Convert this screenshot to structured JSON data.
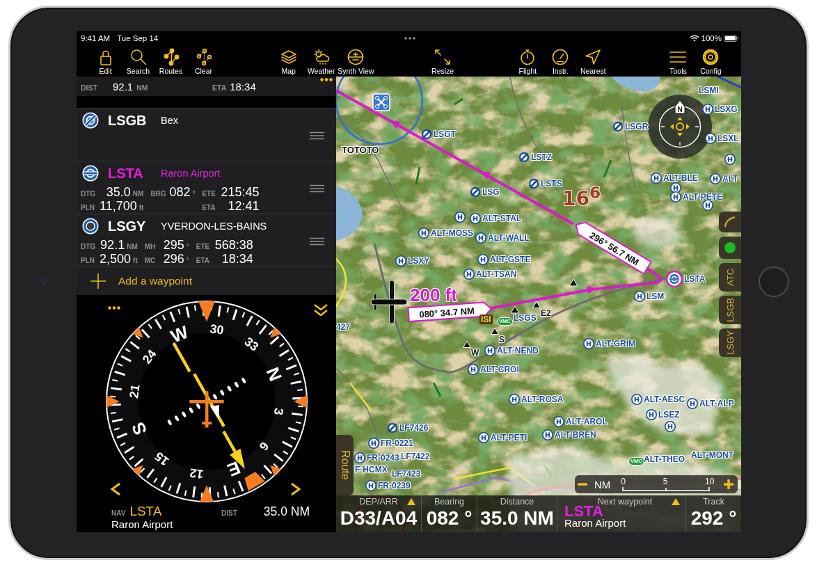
{
  "status_bar": {
    "time": "9:41 AM",
    "date": "Tue Sep 14",
    "battery": "100%"
  },
  "toolbar": {
    "groups": [
      [
        "Edit",
        "Search",
        "Routes",
        "Clear"
      ],
      [
        "Map",
        "Weather",
        "Synth View"
      ],
      [
        "Resize"
      ],
      [
        "Flight",
        "Instr.",
        "Nearest"
      ],
      [
        "Tools",
        "Config"
      ]
    ]
  },
  "route_panel": {
    "summary": [
      {
        "label": "DIST",
        "value": "92.1",
        "unit": "NM"
      },
      {
        "label": "ETA",
        "value": "18:34"
      }
    ],
    "waypoints": [
      {
        "ident": "LSGB",
        "name": "Bex",
        "kind": "aerodrome",
        "active": false
      },
      {
        "ident": "LSTA",
        "name": "Raron Airport",
        "kind": "airport",
        "active": true,
        "stats": [
          [
            {
              "label": "DTG",
              "value": "35.0",
              "unit": "NM"
            },
            {
              "label": "BRG",
              "value": "082",
              "unit": "°"
            },
            {
              "label": "ETE",
              "value": "215:45"
            }
          ],
          [
            {
              "label": "PLN",
              "value": "11,700",
              "unit": "ft"
            },
            {
              "label": "ETA",
              "value": "12:41"
            }
          ]
        ]
      },
      {
        "ident": "LSGY",
        "name": "YVERDON-LES-BAINS",
        "kind": "airfield",
        "active": false,
        "stats": [
          [
            {
              "label": "DTG",
              "value": "92.1",
              "unit": "NM"
            },
            {
              "label": "MH",
              "value": "295",
              "unit": "°"
            },
            {
              "label": "ETE",
              "value": "568:38"
            }
          ],
          [
            {
              "label": "PLN",
              "value": "2,500",
              "unit": "ft"
            },
            {
              "label": "MC",
              "value": "296",
              "unit": "°"
            },
            {
              "label": "ETA",
              "value": "18:34"
            }
          ]
        ]
      }
    ],
    "add_waypoint": "Add a waypoint"
  },
  "compass": {
    "card_labels": [
      "N",
      "3",
      "6",
      "E",
      "12",
      "15",
      "S",
      "21",
      "24",
      "W",
      "30",
      "33"
    ],
    "nav_label": "NAV",
    "nav_ident": "LSTA",
    "nav_name": "Raron Airport",
    "dist_label": "DIST",
    "dist_value": "35.0 NM"
  },
  "map": {
    "north": "N",
    "altitude_tag": "200 ft",
    "legs": [
      "296° 56.7 NM",
      "080° 34.7 NM"
    ],
    "labels": [
      {
        "text": "LSMI",
        "kind": "plain"
      },
      {
        "text": "LSXG",
        "kind": "heliport"
      },
      {
        "text": "LSGR",
        "kind": "airport"
      },
      {
        "text": "LSGT",
        "kind": "airport"
      },
      {
        "text": "LSXL",
        "kind": "heliport"
      },
      {
        "text": "TOTOTO",
        "kind": "waypoint"
      },
      {
        "text": "LSTZ",
        "kind": "airport"
      },
      {
        "text": "ALT-BLE",
        "kind": "heliport"
      },
      {
        "text": "ALT",
        "kind": "heliport"
      },
      {
        "text": "LSTS",
        "kind": "airport"
      },
      {
        "text": "LSG",
        "kind": "airport"
      },
      {
        "text": "16$^{6}$",
        "kind": "elevation"
      },
      {
        "text": "ALT-PETE",
        "kind": "heliport"
      },
      {
        "text": "ALT-STAL",
        "kind": "heliport"
      },
      {
        "text": "ALT-MOSS",
        "kind": "heliport"
      },
      {
        "text": "ALT-WALL",
        "kind": "heliport"
      },
      {
        "text": "ALT-GSTE",
        "kind": "heliport"
      },
      {
        "text": "LSXY",
        "kind": "heliport"
      },
      {
        "text": "ALT-TSAN",
        "kind": "heliport"
      },
      {
        "text": "LSM",
        "kind": "heliport"
      },
      {
        "text": "LSTA",
        "kind": "destination"
      },
      {
        "text": "LSGS",
        "kind": "plain"
      },
      {
        "text": "E2",
        "kind": "fix"
      },
      {
        "text": "ISI",
        "kind": "notice"
      },
      {
        "text": "VMC",
        "kind": "vmc"
      },
      {
        "text": "S",
        "kind": "fix"
      },
      {
        "text": "ALT-GRIM",
        "kind": "heliport"
      },
      {
        "text": "W",
        "kind": "fix"
      },
      {
        "text": "ALT-NEND",
        "kind": "heliport"
      },
      {
        "text": "427",
        "kind": "plain"
      },
      {
        "text": "ALT-CROI",
        "kind": "heliport"
      },
      {
        "text": "ALT-ROSA",
        "kind": "heliport"
      },
      {
        "text": "ALT-AESC",
        "kind": "heliport"
      },
      {
        "text": "ALT-ALP",
        "kind": "heliport"
      },
      {
        "text": "LSEZ",
        "kind": "heliport"
      },
      {
        "text": "ALT-AROL",
        "kind": "heliport"
      },
      {
        "text": "LF7426",
        "kind": "airport"
      },
      {
        "text": "ALT-BREN",
        "kind": "heliport"
      },
      {
        "text": "ALT-PETI",
        "kind": "heliport"
      },
      {
        "text": "FR-0221",
        "kind": "heliport"
      },
      {
        "text": "FR-0243",
        "kind": "heliport"
      },
      {
        "text": "LF7422",
        "kind": "plain"
      },
      {
        "text": "VMC",
        "kind": "vmc"
      },
      {
        "text": "ALT-THEO",
        "kind": "plain"
      },
      {
        "text": "ALT-MONT",
        "kind": "plain"
      },
      {
        "text": "F-HCMX",
        "kind": "plain"
      },
      {
        "text": "LF7423",
        "kind": "plain"
      },
      {
        "text": "FR-0239",
        "kind": "heliport"
      }
    ],
    "side_tabs": [
      {
        "kind": "icon"
      },
      {
        "kind": "status",
        "color": "#1cb82a"
      },
      {
        "kind": "text",
        "label": "ATC"
      },
      {
        "kind": "text",
        "label": "LSGB"
      },
      {
        "kind": "text",
        "label": "LSGY"
      }
    ],
    "route_tab": "Route",
    "scale": {
      "unit": "NM",
      "ticks": [
        "0",
        "5",
        "10"
      ]
    }
  },
  "info_bar": [
    {
      "label": "DEP/ARR",
      "value": "D33/A04",
      "kind": "value",
      "menu": true
    },
    {
      "label": "Bearing",
      "value": "082 °",
      "kind": "value",
      "menu": false
    },
    {
      "label": "Distance",
      "value": "35.0 NM",
      "kind": "value",
      "menu": false
    },
    {
      "label": "Next waypoint",
      "value": "LSTA",
      "detail": "Raron Airport",
      "kind": "waypoint",
      "menu": true
    },
    {
      "label": "Track",
      "value": "292 °",
      "kind": "value",
      "menu": false
    }
  ]
}
